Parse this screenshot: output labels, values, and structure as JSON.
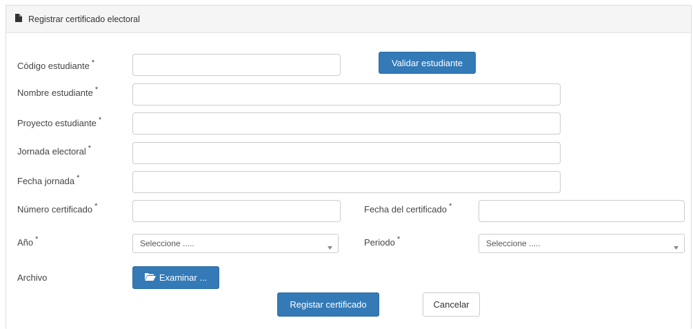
{
  "panel": {
    "title": "Registrar certificado electoral",
    "icon": "file-icon"
  },
  "form": {
    "codigo": {
      "label": "Código estudiante",
      "required": "*",
      "value": ""
    },
    "validar_button": "Validar estudiante",
    "nombre": {
      "label": "Nombre estudiante",
      "required": "*",
      "value": ""
    },
    "proyecto": {
      "label": "Proyecto estudiante",
      "required": "*",
      "value": ""
    },
    "jornada": {
      "label": "Jornada electoral",
      "required": "*",
      "value": ""
    },
    "fecha_jornada": {
      "label": "Fecha jornada",
      "required": "*",
      "value": ""
    },
    "numero_certificado": {
      "label": "Número certificado",
      "required": "*",
      "value": ""
    },
    "fecha_certificado": {
      "label": "Fecha del certificado",
      "required": "*",
      "value": ""
    },
    "anio": {
      "label": "Año",
      "required": "*",
      "selected": "Seleccione ....."
    },
    "periodo": {
      "label": "Periodo",
      "required": "*",
      "selected": "Seleccione ....."
    },
    "archivo": {
      "label": "Archivo",
      "button": "Examinar ...",
      "icon": "folder-open-icon"
    }
  },
  "actions": {
    "submit": "Registar certificado",
    "cancel": "Cancelar"
  },
  "colors": {
    "primary": "#337ab7",
    "border": "#cccccc",
    "heading_bg": "#f5f5f5"
  }
}
